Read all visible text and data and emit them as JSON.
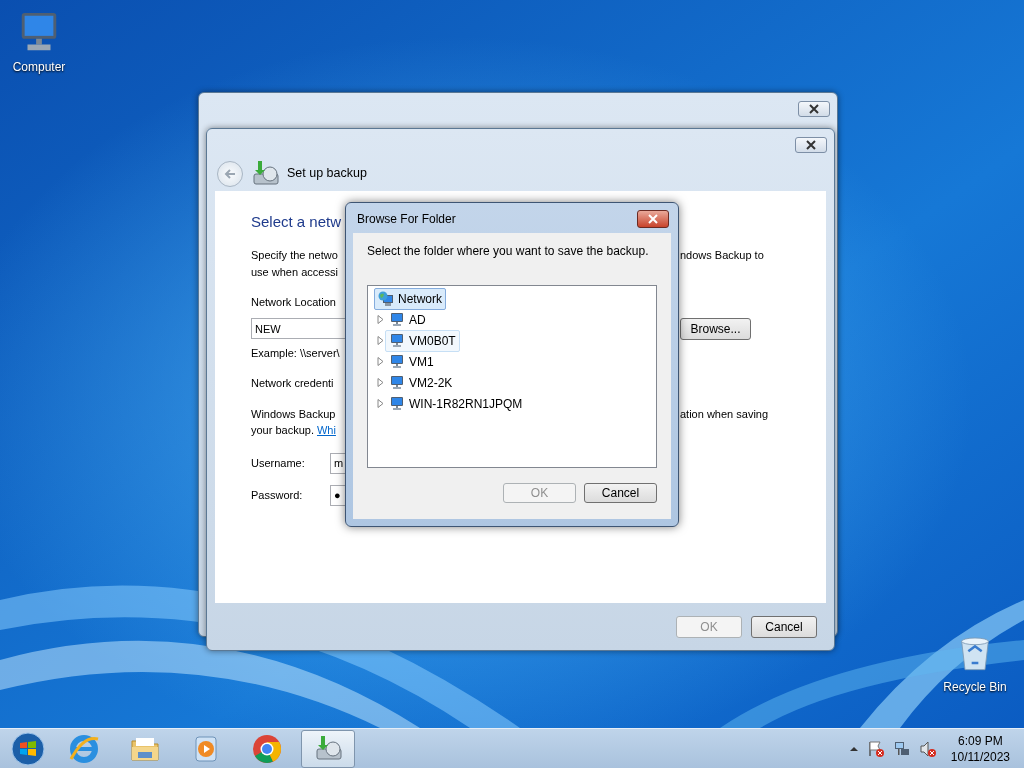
{
  "desktop_icons": [
    {
      "kind": "computer",
      "label": "Computer"
    },
    {
      "kind": "recycle_bin",
      "label": "Recycle Bin"
    }
  ],
  "wizard": {
    "title": "Set up backup",
    "sections": [
      [
        {
          "kind": "heading",
          "left": "Select a netw"
        }
      ],
      [
        {
          "kind": "text",
          "left": "Specify the netwo",
          "right": "ndows Backup to"
        },
        {
          "kind": "text",
          "left": "use when accessi"
        }
      ],
      [
        {
          "kind": "text",
          "left": "Network Location"
        },
        {
          "kind": "field",
          "value": "NEW",
          "right": "Browse..."
        },
        {
          "kind": "text",
          "left": "Example: \\\\server\\"
        }
      ],
      [
        {
          "kind": "text",
          "left": "Network credenti"
        }
      ],
      [
        {
          "kind": "text",
          "left": "Windows Backup",
          "right": "ation when saving"
        },
        {
          "kind": "link_text",
          "left": "your backup.",
          "link": "Whi"
        }
      ],
      [
        {
          "kind": "labeled_field",
          "left": "Username:",
          "value": "m"
        },
        {
          "kind": "labeled_field",
          "left": "Password:",
          "value": "●"
        }
      ]
    ],
    "buttons": [
      {
        "label": "OK",
        "disabled": true
      },
      {
        "label": "Cancel",
        "disabled": false
      }
    ]
  },
  "dialog": {
    "title": "Browse For Folder",
    "prompt": "Select the folder where you want to save the backup.",
    "tree": [
      {
        "label": "Network",
        "kind": "network",
        "selected": true,
        "hot": false,
        "children": [
          {
            "label": "AD",
            "kind": "computer",
            "selected": false,
            "hot": false,
            "expanded": false
          },
          {
            "label": "VM0B0T",
            "kind": "computer",
            "selected": false,
            "hot": true,
            "expanded": false
          },
          {
            "label": "VM1",
            "kind": "computer",
            "selected": false,
            "hot": false,
            "expanded": false
          },
          {
            "label": "VM2-2K",
            "kind": "computer",
            "selected": false,
            "hot": false,
            "expanded": false
          },
          {
            "label": "WIN-1R82RN1JPQM",
            "kind": "computer",
            "selected": false,
            "hot": false,
            "expanded": false
          }
        ]
      }
    ],
    "buttons": [
      {
        "label": "OK",
        "disabled": true
      },
      {
        "label": "Cancel",
        "disabled": false
      }
    ]
  },
  "taskbar": {
    "apps": [
      {
        "kind": "ie",
        "active": false
      },
      {
        "kind": "folder",
        "active": false
      },
      {
        "kind": "media",
        "active": false
      },
      {
        "kind": "chrome",
        "active": false
      },
      {
        "kind": "backup",
        "active": true
      }
    ],
    "tray": [
      {
        "kind": "chevron"
      },
      {
        "kind": "flag"
      },
      {
        "kind": "network"
      },
      {
        "kind": "speaker"
      }
    ],
    "time": "6:09 PM",
    "date": "10/11/2023"
  }
}
